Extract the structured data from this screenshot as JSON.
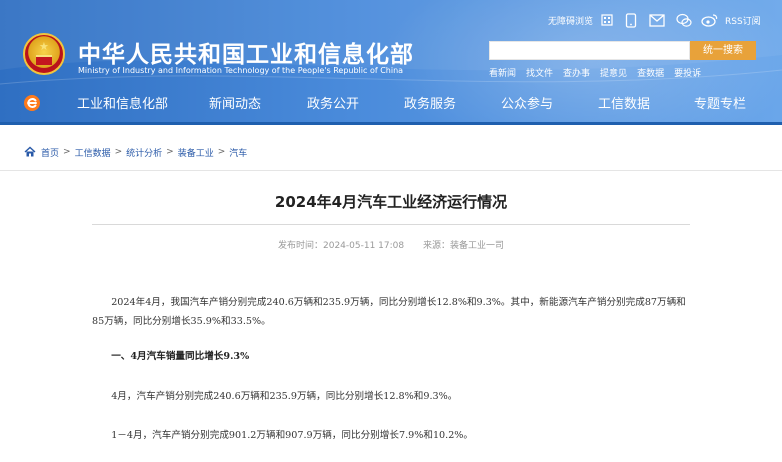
{
  "header": {
    "site_title": "中华人民共和国工业和信息化部",
    "site_subtitle": "Ministry of Industry and Information Technology of the People's Republic of China",
    "accessibility": "无障碍浏览",
    "rss": "RSS订阅",
    "search": {
      "placeholder": "",
      "button_label": "统一搜索"
    },
    "quick_links": [
      "看新闻",
      "找文件",
      "查办事",
      "提意见",
      "查数据",
      "要投诉"
    ]
  },
  "nav": {
    "items": [
      "工业和信息化部",
      "新闻动态",
      "政务公开",
      "政务服务",
      "公众参与",
      "工信数据",
      "专题专栏"
    ]
  },
  "breadcrumb": [
    "首页",
    "工信数据",
    "统计分析",
    "装备工业",
    "汽车"
  ],
  "article": {
    "title": "2024年4月汽车工业经济运行情况",
    "published": "发布时间：2024-05-11 17:08",
    "source": "来源：装备工业一司",
    "paragraphs": [
      "2024年4月，我国汽车产销分别完成240.6万辆和235.9万辆，同比分别增长12.8%和9.3%。其中，新能源汽车产销分别完成87万辆和85万辆，同比分别增长35.9%和33.5%。",
      "一、4月汽车销量同比增长9.3%",
      "4月，汽车产销分别完成240.6万辆和235.9万辆，同比分别增长12.8%和9.3%。",
      "1－4月，汽车产销分别完成901.2万辆和907.9万辆，同比分别增长7.9%和10.2%。"
    ]
  },
  "colors": {
    "header_blue": "#2f6fc2",
    "search_button": "#e8a23a",
    "link_blue": "#2a5aa8",
    "home_icon_orange": "#ff7a1a"
  },
  "icons": [
    "emblem",
    "mobile-icon",
    "weibo-qr-icon",
    "phone-app-icon",
    "email-icon",
    "wechat-icon",
    "weibo-icon",
    "home-icon",
    "brand-e-icon"
  ]
}
